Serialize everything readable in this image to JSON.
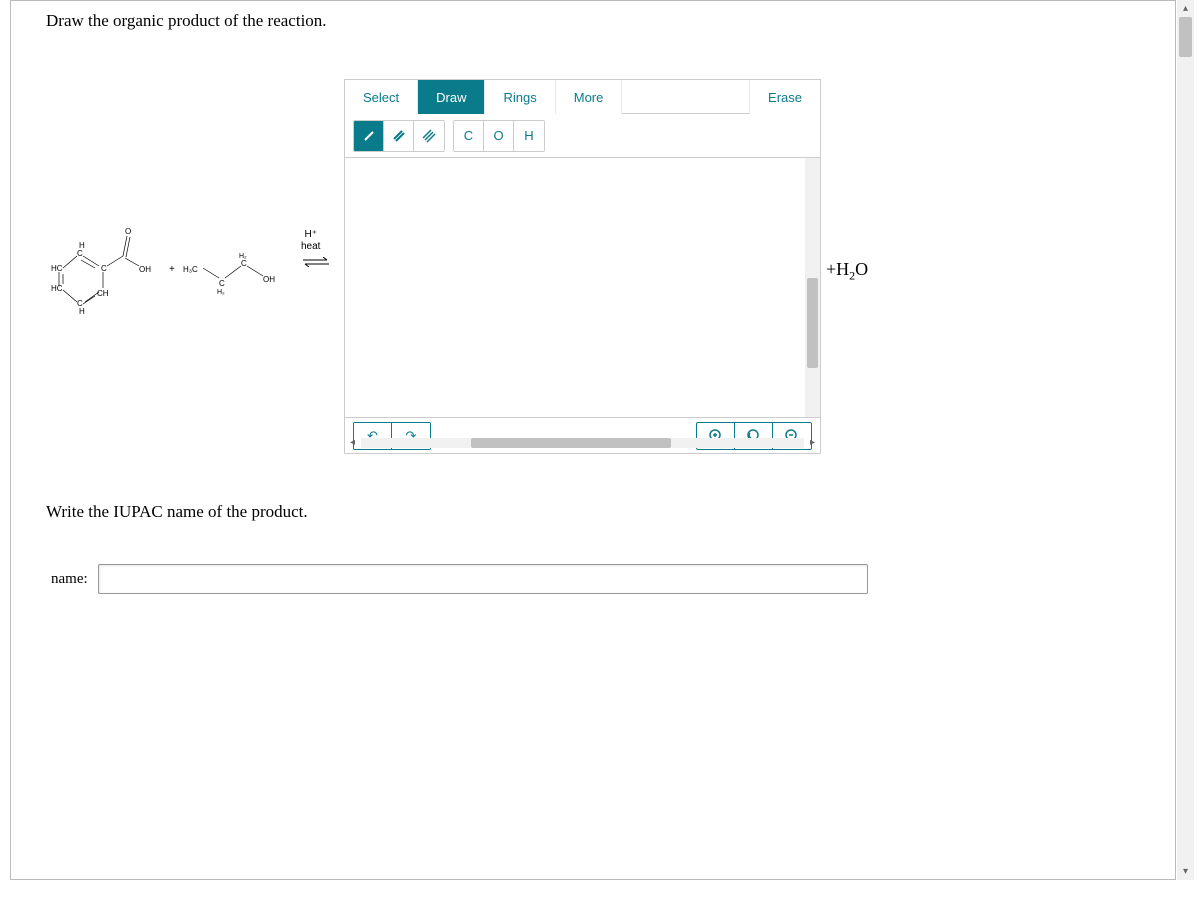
{
  "prompts": {
    "draw": "Draw the organic product of the reaction.",
    "name": "Write the IUPAC name of the product."
  },
  "reaction": {
    "reagent1_labels": {
      "hc1": "HC",
      "hc2": "HC",
      "ch_top": "H",
      "c1": "C",
      "c2": "C",
      "c3": "C",
      "ch_bot": "CH",
      "h_bot": "H",
      "o": "O",
      "oh": "OH"
    },
    "plus": "+",
    "reagent2_labels": {
      "h3c": "H₃C",
      "h2a": "H₂",
      "c1": "C",
      "c2": "C",
      "h2b": "H₂",
      "c3": "C",
      "oh": "OH"
    },
    "conditions_top": "H⁺",
    "conditions_bottom": "heat"
  },
  "editor": {
    "toolbar": {
      "select": "Select",
      "draw": "Draw",
      "rings": "Rings",
      "more": "More",
      "erase": "Erase"
    },
    "bonds": {
      "single_tip": "single",
      "double_tip": "double",
      "triple_tip": "triple"
    },
    "atoms": {
      "c": "C",
      "o": "O",
      "h": "H"
    },
    "history": {
      "undo_icon": "↶",
      "redo_icon": "↷"
    },
    "zoom": {
      "in_icon": "⊕",
      "fit_icon": "⤾",
      "out_icon": "⊖"
    }
  },
  "byproduct": {
    "text": "+H₂O"
  },
  "name_field": {
    "label": "name:",
    "value": ""
  }
}
